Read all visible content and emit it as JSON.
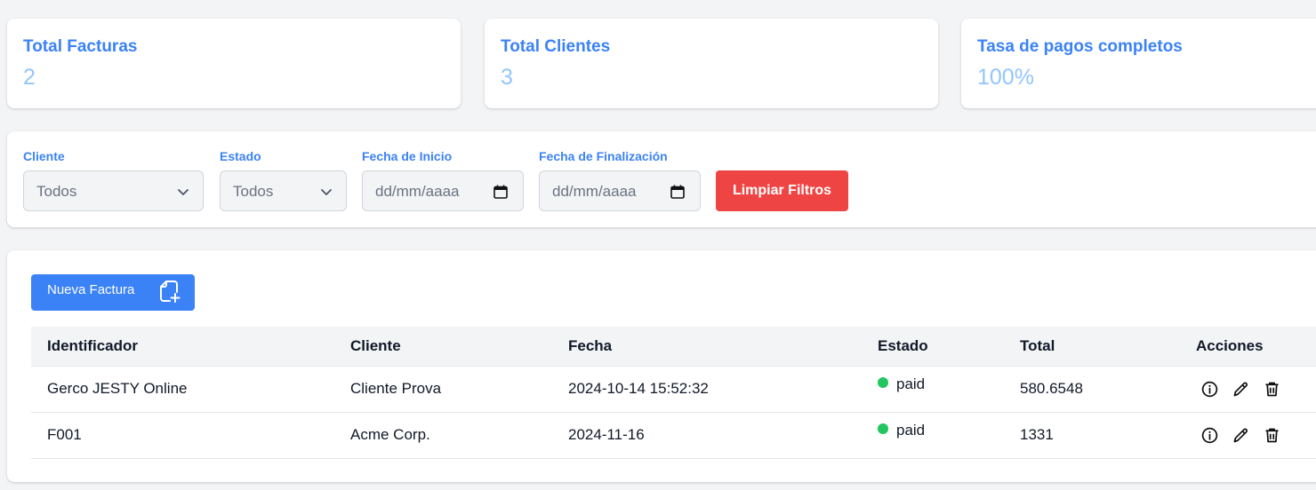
{
  "stats": [
    {
      "label": "Total Facturas",
      "value": "2"
    },
    {
      "label": "Total Clientes",
      "value": "3"
    },
    {
      "label": "Tasa de pagos completos",
      "value": "100%"
    }
  ],
  "filters": {
    "client_label": "Cliente",
    "client_value": "Todos",
    "status_label": "Estado",
    "status_value": "Todos",
    "start_label": "Fecha de Inicio",
    "start_placeholder": "dd/mm/aaaa",
    "end_label": "Fecha de Finalización",
    "end_placeholder": "dd/mm/aaaa",
    "clear_label": "Limpiar Filtros",
    "clear_color": "#ef4444"
  },
  "toolbar": {
    "new_label": "Nueva Factura",
    "new_icon": "file-plus-icon",
    "accent": "#3b82f6"
  },
  "table": {
    "headers": [
      "Identificador",
      "Cliente",
      "Fecha",
      "Estado",
      "Total",
      "Acciones"
    ],
    "rows": [
      {
        "id": "Gerco JESTY Online",
        "client": "Cliente Prova",
        "date": "2024-10-14 15:52:32",
        "status": "paid",
        "total": "580.6548"
      },
      {
        "id": "F001",
        "client": "Acme Corp.",
        "date": "2024-11-16",
        "status": "paid",
        "total": "1331"
      }
    ],
    "status_color": "#22c55e",
    "action_icons": [
      "info-icon",
      "edit-icon",
      "trash-icon"
    ]
  }
}
